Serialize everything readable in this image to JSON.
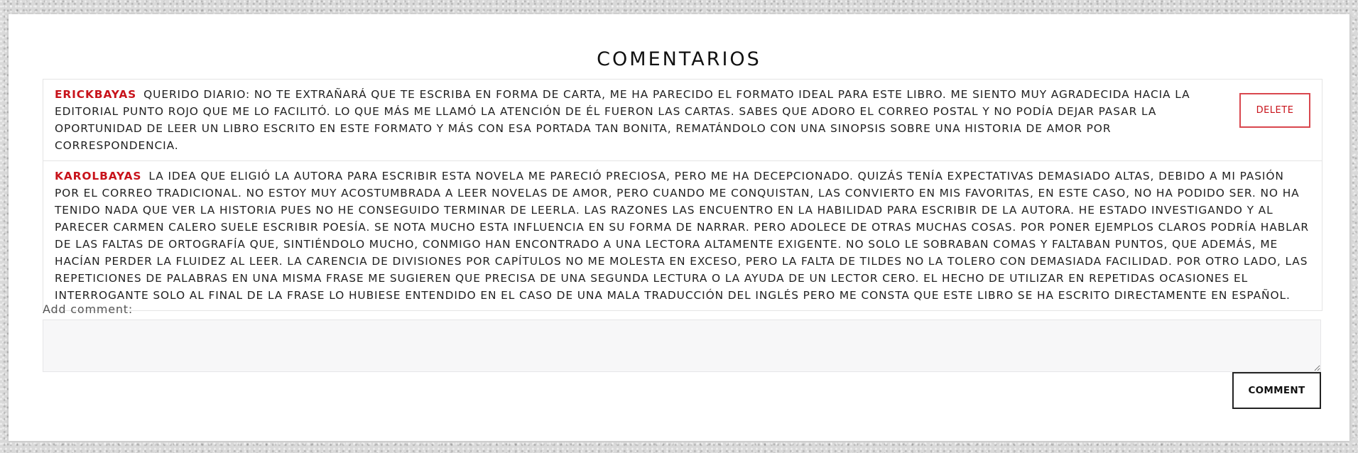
{
  "section": {
    "title": "COMENTARIOS"
  },
  "comments": [
    {
      "author": "ERICKBAYAS",
      "text": "QUERIDO DIARIO: NO TE EXTRAÑARÁ QUE TE ESCRIBA EN FORMA DE CARTA, ME HA PARECIDO EL FORMATO IDEAL PARA ESTE LIBRO. ME SIENTO MUY AGRADECIDA HACIA LA EDITORIAL PUNTO ROJO QUE ME LO FACILITÓ. LO QUE MÁS ME LLAMÓ LA ATENCIÓN DE ÉL FUERON LAS CARTAS. SABES QUE ADORO EL CORREO POSTAL Y NO PODÍA DEJAR PASAR LA OPORTUNIDAD DE LEER UN LIBRO ESCRITO EN ESTE FORMATO Y MÁS CON ESA PORTADA TAN BONITA, REMATÁNDOLO CON UNA SINOPSIS SOBRE UNA HISTORIA DE AMOR POR CORRESPONDENCIA.",
      "delete_label": "DELETE"
    },
    {
      "author": "KAROLBAYAS",
      "text": "LA IDEA QUE ELIGIÓ LA AUTORA PARA ESCRIBIR ESTA NOVELA ME PARECIÓ PRECIOSA, PERO ME HA DECEPCIONADO. QUIZÁS TENÍA EXPECTATIVAS DEMASIADO ALTAS, DEBIDO A MI PASIÓN POR EL CORREO TRADICIONAL. NO ESTOY MUY ACOSTUMBRADA A LEER NOVELAS DE AMOR, PERO CUANDO ME CONQUISTAN, LAS CONVIERTO EN MIS FAVORITAS, EN ESTE CASO, NO HA PODIDO SER. NO HA TENIDO NADA QUE VER LA HISTORIA PUES NO HE CONSEGUIDO TERMINAR DE LEERLA. LAS RAZONES LAS ENCUENTRO EN LA HABILIDAD PARA ESCRIBIR DE LA AUTORA. HE ESTADO INVESTIGANDO Y AL PARECER CARMEN CALERO SUELE ESCRIBIR POESÍA. SE NOTA MUCHO ESTA INFLUENCIA EN SU FORMA DE NARRAR. PERO ADOLECE DE OTRAS MUCHAS COSAS. POR PONER EJEMPLOS CLAROS PODRÍA HABLAR DE LAS FALTAS DE ORTOGRAFÍA QUE, SINTIÉNDOLO MUCHO, CONMIGO HAN ENCONTRADO A UNA LECTORA ALTAMENTE EXIGENTE. NO SOLO LE SOBRABAN COMAS Y FALTABAN PUNTOS, QUE ADEMÁS, ME HACÍAN PERDER LA FLUIDEZ AL LEER. LA CARENCIA DE DIVISIONES POR CAPÍTULOS NO ME MOLESTA EN EXCESO, PERO LA FALTA DE TILDES NO LA TOLERO CON DEMASIADA FACILIDAD. POR OTRO LADO, LAS REPETICIONES DE PALABRAS EN UNA MISMA FRASE ME SUGIEREN QUE PRECISA DE UNA SEGUNDA LECTURA O LA AYUDA DE UN LECTOR CERO. EL HECHO DE UTILIZAR EN REPETIDAS OCASIONES EL INTERROGANTE SOLO AL FINAL DE LA FRASE LO HUBIESE ENTENDIDO EN EL CASO DE UNA MALA TRADUCCIÓN DEL INGLÉS PERO ME CONSTA QUE ESTE LIBRO SE HA ESCRITO DIRECTAMENTE EN ESPAÑOL."
    }
  ],
  "form": {
    "label": "Add comment:",
    "value": "",
    "submit_label": "COMMENT"
  },
  "colors": {
    "author": "#c8131b",
    "delete_border": "#d9474e",
    "panel": "#ffffff"
  }
}
